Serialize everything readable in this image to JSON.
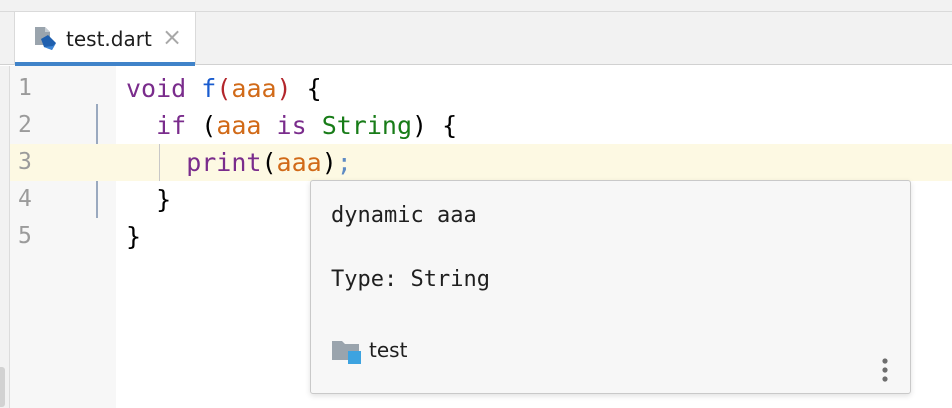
{
  "editor": {
    "tab": {
      "filename": "test.dart",
      "close_glyph": "×",
      "icon": "dart-file-icon"
    },
    "lines": [
      {
        "number": "1",
        "tokens": [
          {
            "text": "void ",
            "cls": "kw"
          },
          {
            "text": "f",
            "cls": "fn"
          },
          {
            "text": "(",
            "cls": "par"
          },
          {
            "text": "aaa",
            "cls": "prm"
          },
          {
            "text": ")",
            "cls": "par"
          },
          {
            "text": " {",
            "cls": "blk"
          }
        ]
      },
      {
        "number": "2",
        "tokens": [
          {
            "text": "  if ",
            "cls": "kw"
          },
          {
            "text": "(",
            "cls": "blk"
          },
          {
            "text": "aaa",
            "cls": "prm"
          },
          {
            "text": " is ",
            "cls": "kw"
          },
          {
            "text": "String",
            "cls": "typ"
          },
          {
            "text": ") {",
            "cls": "blk"
          }
        ]
      },
      {
        "number": "3",
        "tokens": [
          {
            "text": "    print",
            "cls": "kw"
          },
          {
            "text": "(",
            "cls": "blk"
          },
          {
            "text": "aaa",
            "cls": "prm"
          },
          {
            "text": ")",
            "cls": "blk"
          },
          {
            "text": ";",
            "cls": "semi"
          }
        ]
      },
      {
        "number": "4",
        "tokens": [
          {
            "text": "  }",
            "cls": "blk"
          }
        ]
      },
      {
        "number": "5",
        "tokens": [
          {
            "text": "}",
            "cls": "blk"
          }
        ]
      }
    ]
  },
  "popup": {
    "signature": "dynamic aaa",
    "type_line": "Type: String",
    "module_label": "test",
    "module_icon": "module-folder-icon",
    "more_icon": "more-vertical-icon"
  },
  "colors": {
    "keyword": "#7a2c8c",
    "function": "#1a5ccf",
    "parameter": "#d16a18",
    "type": "#187c18",
    "current_line": "#fdf9e3",
    "tab_accent": "#4083c9"
  }
}
